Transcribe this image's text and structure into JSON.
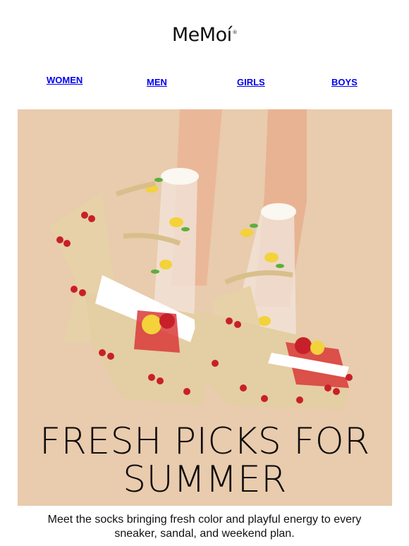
{
  "brand": {
    "name": "MeMoi",
    "logo_text": "MeMoí",
    "reg_mark": "®"
  },
  "nav": {
    "items": [
      {
        "label": "WOMEN"
      },
      {
        "label": "MEN"
      },
      {
        "label": "GIRLS"
      },
      {
        "label": "BOYS"
      }
    ]
  },
  "hero": {
    "headline_line1": "FRESH PICKS FOR",
    "headline_line2": "SUMMER",
    "background_color": "#e9cbad"
  },
  "body": {
    "text": "Meet the socks bringing fresh color and playful energy to every sneaker, sandal, and weekend plan."
  },
  "colors": {
    "link": "#0000ee",
    "text": "#111111"
  }
}
